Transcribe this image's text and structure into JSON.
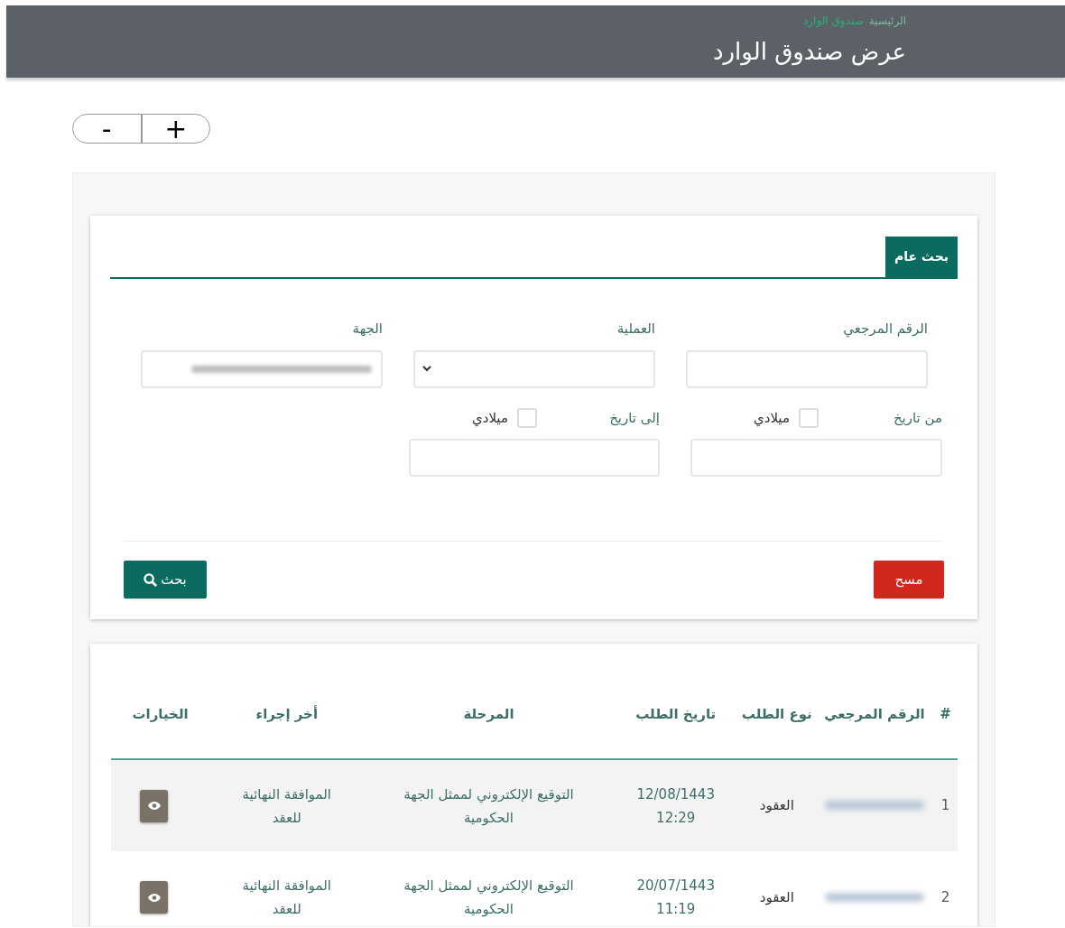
{
  "header": {
    "breadcrumb": [
      {
        "label": "الرئيسية",
        "current": false
      },
      {
        "label": "صندوق الوارد",
        "current": true
      }
    ],
    "title": "عرض صندوق الوارد"
  },
  "zoom_controls": [
    "+",
    "-"
  ],
  "search_panel": {
    "tab": "بحث عام",
    "fields": [
      {
        "kind": "text",
        "label": "الرقم المرجعي"
      },
      {
        "kind": "select",
        "label": "العملية"
      },
      {
        "kind": "redacted",
        "label": "الجهة"
      }
    ],
    "date_fields": [
      {
        "label": "من تاريخ",
        "checkbox_label": "ميلادي",
        "checked": false
      },
      {
        "label": "إلى تاريخ",
        "checkbox_label": "ميلادي",
        "checked": false
      }
    ],
    "buttons": [
      {
        "kind": "clear",
        "label": "مسح"
      },
      {
        "kind": "search",
        "label": "بحث"
      }
    ]
  },
  "table": {
    "columns": [
      {
        "kind": "number",
        "label": "#"
      },
      {
        "kind": "reference",
        "label": "الرقم المرجعي"
      },
      {
        "kind": "type",
        "label": "نوع الطلب"
      },
      {
        "kind": "date",
        "label": "تاريخ الطلب"
      },
      {
        "kind": "stage",
        "label": "المرحلة"
      },
      {
        "kind": "last_action",
        "label": "أخر إجراء"
      },
      {
        "kind": "options",
        "label": "الخيارات"
      }
    ],
    "rows": [
      {
        "number": "1",
        "type": "العقود",
        "date": "12/08/1443",
        "time": "12:29",
        "stage": "التوقيع الإلكتروني لممثل الجهة الحكومية",
        "last_action": "الموافقة النهائية للعقد",
        "hovered": true
      },
      {
        "number": "2",
        "type": "العقود",
        "date": "20/07/1443",
        "time": "11:19",
        "stage": "التوقيع الإلكتروني لممثل الجهة الحكومية",
        "last_action": "الموافقة النهائية للعقد",
        "hovered": false
      }
    ]
  }
}
